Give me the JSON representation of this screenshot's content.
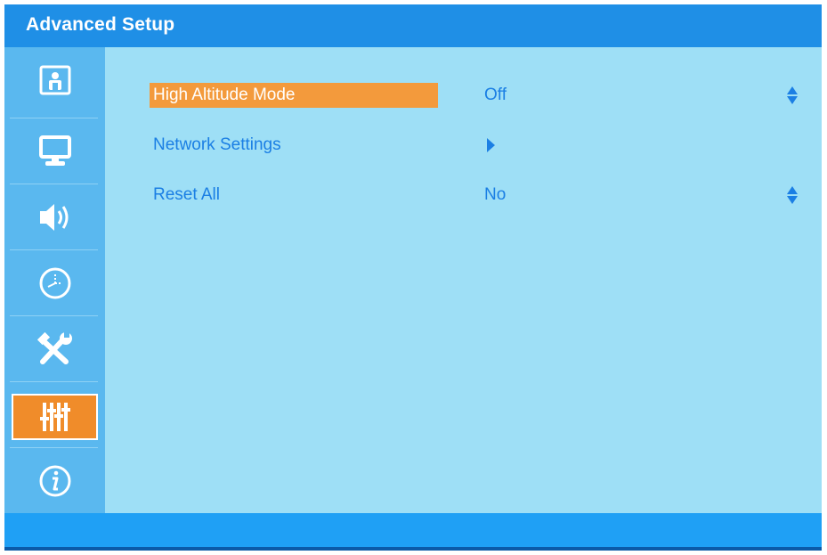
{
  "window": {
    "title": "Advanced Setup"
  },
  "sidebar": {
    "items": [
      {
        "icon": "picture-settings-icon",
        "selected": false
      },
      {
        "icon": "display-monitor-icon",
        "selected": false
      },
      {
        "icon": "speaker-audio-icon",
        "selected": false
      },
      {
        "icon": "clock-timer-icon",
        "selected": false
      },
      {
        "icon": "tools-wrench-icon",
        "selected": false
      },
      {
        "icon": "advanced-sliders-icon",
        "selected": true
      },
      {
        "icon": "info-icon",
        "selected": false
      }
    ]
  },
  "menu": {
    "rows": [
      {
        "label": "High Altitude Mode",
        "value": "Off",
        "control": "up-down",
        "highlighted": true
      },
      {
        "label": "Network Settings",
        "value": "",
        "control": "submenu-arrow",
        "highlighted": false
      },
      {
        "label": "Reset All",
        "value": "No",
        "control": "up-down",
        "highlighted": false
      }
    ]
  },
  "colors": {
    "accent": "#1f8fe6",
    "highlight": "#f39a3c",
    "text": "#1b7fe4",
    "panel": "#9edff6",
    "sidebar": "#5ab8ef"
  }
}
